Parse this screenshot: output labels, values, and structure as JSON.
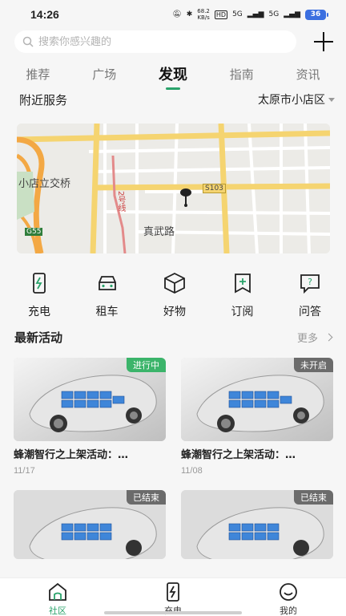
{
  "status_bar": {
    "time": "14:26",
    "net_speed": "68.2",
    "net_unit": "KB/s",
    "hd": "HD",
    "signal1": "5G",
    "signal2": "5G",
    "battery": "36"
  },
  "search": {
    "placeholder": "搜索你感兴趣的"
  },
  "tabs": [
    {
      "label": "推荐",
      "active": false
    },
    {
      "label": "广场",
      "active": false
    },
    {
      "label": "发现",
      "active": true
    },
    {
      "label": "指南",
      "active": false
    },
    {
      "label": "资讯",
      "active": false
    }
  ],
  "nearby": {
    "label": "附近服务",
    "location": "太原市小店区"
  },
  "map": {
    "labels": {
      "interchange": "小店立交桥",
      "road": "真武路",
      "route": "2号线",
      "s103": "S103",
      "g55": "G55"
    }
  },
  "services": [
    {
      "label": "充电",
      "icon": "charge-icon"
    },
    {
      "label": "租车",
      "icon": "car-icon"
    },
    {
      "label": "好物",
      "icon": "box-icon"
    },
    {
      "label": "订阅",
      "icon": "subscribe-icon"
    },
    {
      "label": "问答",
      "icon": "qa-icon"
    }
  ],
  "activities": {
    "title": "最新活动",
    "more": "更多",
    "items": [
      {
        "title": "蜂潮智行之上架活动：…",
        "date": "11/17",
        "status": "进行中"
      },
      {
        "title": "蜂潮智行之上架活动：…",
        "date": "11/08",
        "status": "未开启"
      },
      {
        "title": "",
        "date": "",
        "status": "已结束"
      },
      {
        "title": "",
        "date": "",
        "status": "已结束"
      }
    ]
  },
  "bottom_nav": [
    {
      "label": "社区",
      "active": true
    },
    {
      "label": "充电",
      "active": false
    },
    {
      "label": "我的",
      "active": false
    }
  ],
  "colors": {
    "accent": "#2aa36b",
    "badge_active": "#3bb46a",
    "badge_inactive": "#6b6b6b",
    "battery": "#3b6fe0"
  }
}
